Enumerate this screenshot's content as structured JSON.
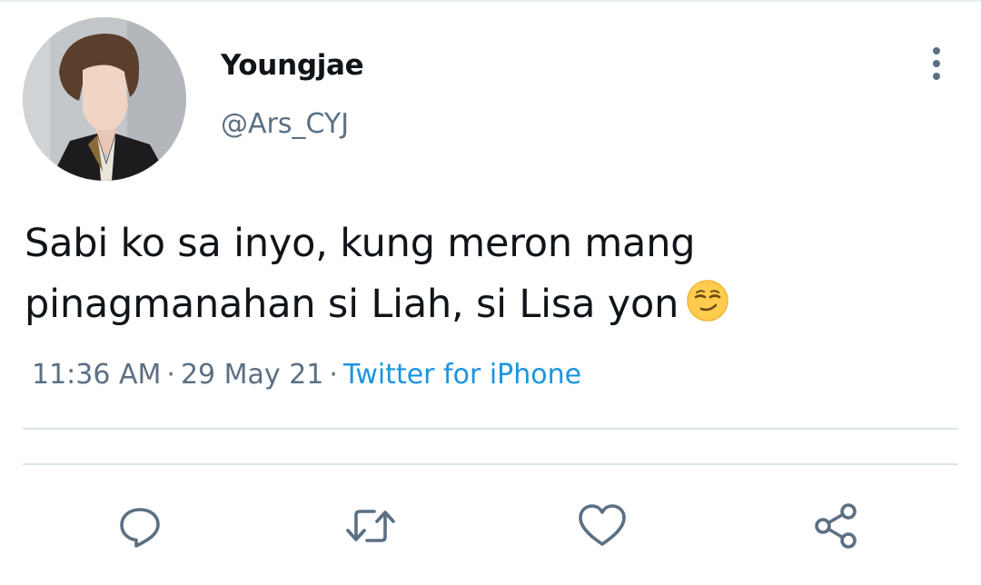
{
  "tweet": {
    "author": {
      "display_name": "Youngjae",
      "handle": "@Ars_CYJ",
      "avatar": "profile-photo"
    },
    "text_lines": [
      "Sabi ko sa inyo, kung meron mang",
      "pinagmanahan si Liah, si Lisa yon"
    ],
    "emoji": "smirking-face-emoji",
    "time": "11:36 AM",
    "date": "29 May 21",
    "separator": "·",
    "source": "Twitter for iPhone"
  },
  "actions": {
    "reply": "reply-icon",
    "retweet": "retweet-icon",
    "like": "heart-icon",
    "share": "share-icon",
    "more": "more-vertical-icon"
  },
  "colors": {
    "text": "#0f1419",
    "secondary": "#5b7083",
    "link": "#1b95e0",
    "icon": "#5b7083",
    "divider": "#dfe5ea"
  }
}
